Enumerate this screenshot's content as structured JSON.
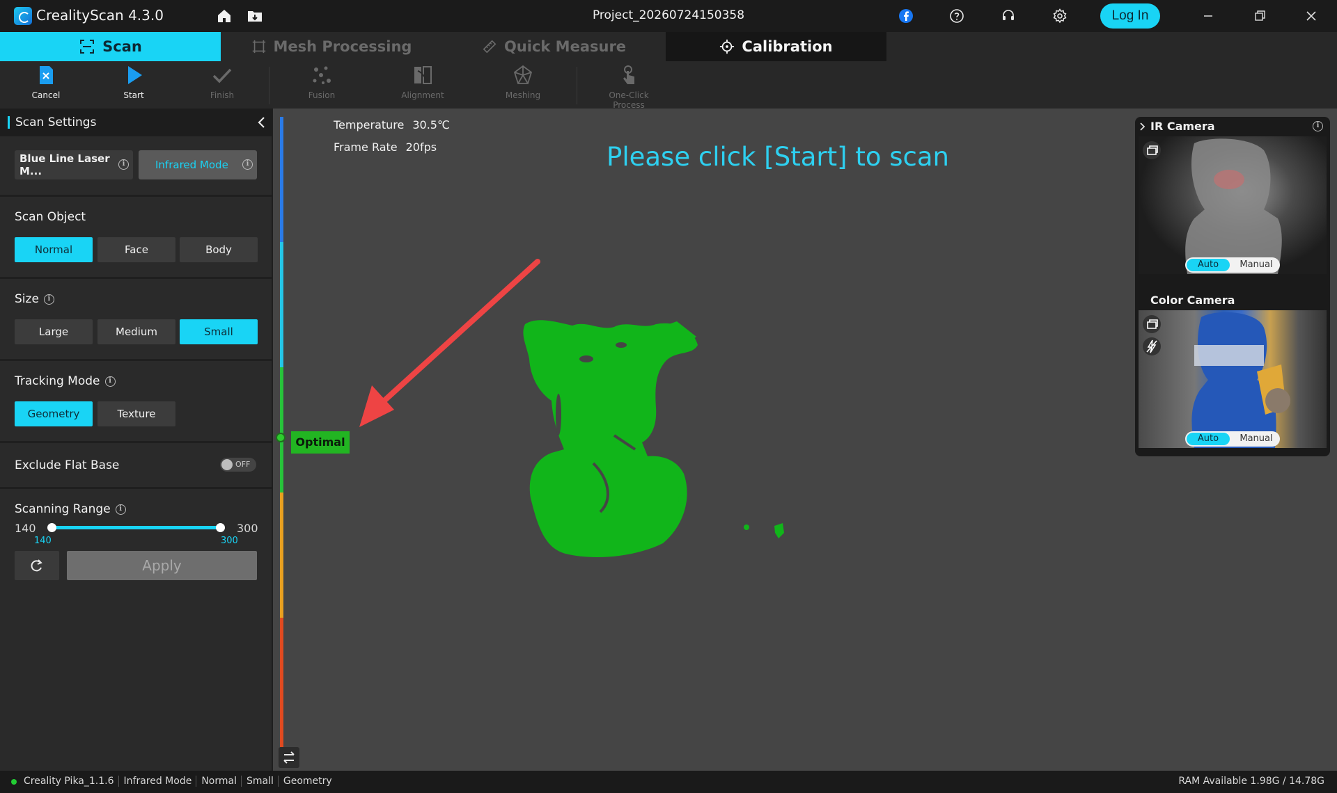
{
  "app": {
    "title": "CrealityScan 4.3.0",
    "project": "Project_20260724150358",
    "login_label": "Log In",
    "accent": "#19d4f5"
  },
  "tabs": [
    {
      "label": "Scan",
      "icon": "scan-frame-icon",
      "active": true
    },
    {
      "label": "Mesh Processing",
      "icon": "mesh-icon"
    },
    {
      "label": "Quick Measure",
      "icon": "ruler-icon"
    },
    {
      "label": "Calibration",
      "icon": "crosshair-icon"
    }
  ],
  "toolbar": {
    "cancel": "Cancel",
    "start": "Start",
    "finish": "Finish",
    "fusion": "Fusion",
    "alignment": "Alignment",
    "meshing": "Meshing",
    "one_click": "One-Click Process"
  },
  "settings": {
    "header": "Scan Settings",
    "mode_blue": "Blue Line Laser M...",
    "mode_ir": "Infrared Mode",
    "scan_object": {
      "label": "Scan Object",
      "options": [
        "Normal",
        "Face",
        "Body"
      ],
      "selected": "Normal"
    },
    "size": {
      "label": "Size",
      "options": [
        "Large",
        "Medium",
        "Small"
      ],
      "selected": "Small"
    },
    "tracking": {
      "label": "Tracking Mode",
      "options": [
        "Geometry",
        "Texture"
      ],
      "selected": "Geometry"
    },
    "exclude_flat_base": {
      "label": "Exclude Flat Base",
      "state": "OFF"
    },
    "scanning_range": {
      "label": "Scanning Range",
      "min": "140",
      "max": "300",
      "low_value": "140",
      "high_value": "300"
    },
    "apply": "Apply"
  },
  "viewport": {
    "temperature_label": "Temperature",
    "temperature_value": "30.5℃",
    "frame_rate_label": "Frame Rate",
    "frame_rate_value": "20fps",
    "prompt": "Please click [Start] to scan",
    "distance_status": "Optimal",
    "point_cloud_color": "#11b51a",
    "arrow_color": "#ee4444"
  },
  "cameras": {
    "ir_title": "IR Camera",
    "color_title": "Color Camera",
    "auto": "Auto",
    "manual": "Manual"
  },
  "status": {
    "device": "Creality Pika_1.1.6",
    "mode": "Infrared Mode",
    "object": "Normal",
    "size": "Small",
    "tracking": "Geometry",
    "ram": "RAM Available 1.98G / 14.78G"
  }
}
